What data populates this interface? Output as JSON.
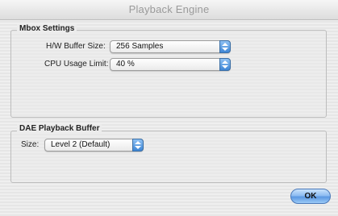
{
  "window": {
    "title": "Playback Engine"
  },
  "mbox": {
    "group_label": "Mbox Settings",
    "buffer_label": "H/W Buffer Size:",
    "buffer_value": "256 Samples",
    "cpu_label": "CPU Usage Limit:",
    "cpu_value": "40 %"
  },
  "dae": {
    "group_label": "DAE Playback Buffer",
    "size_label": "Size:",
    "size_value": "Level 2 (Default)"
  },
  "buttons": {
    "ok_label": "OK"
  },
  "colors": {
    "accent": "#5b98e2"
  }
}
